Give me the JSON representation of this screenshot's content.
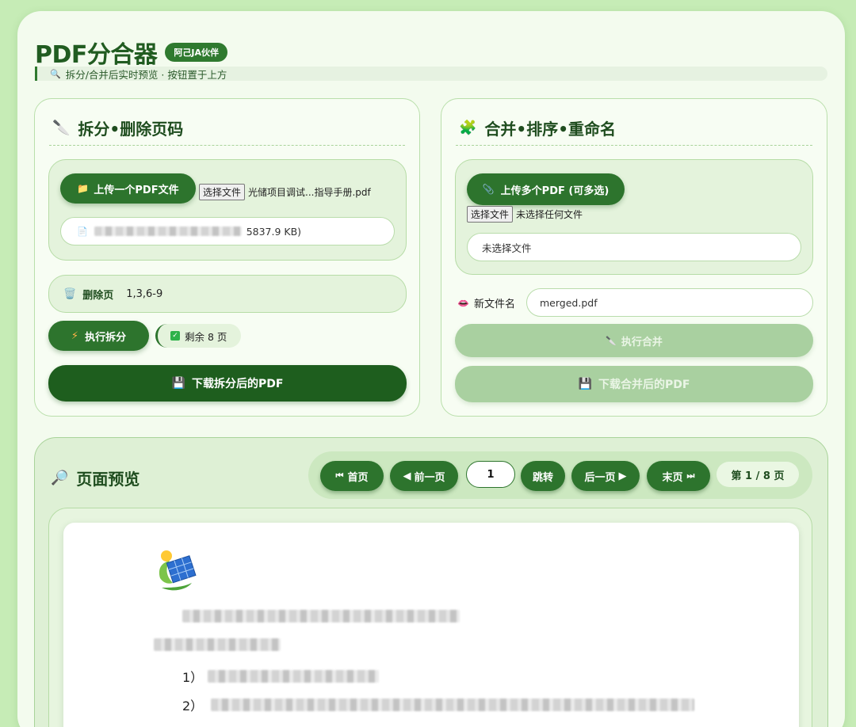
{
  "header": {
    "title": "PDF分合器",
    "badge": "阿己JA伙伴",
    "subtitle": "拆分/合并后实时预览 · 按钮置于上方"
  },
  "split": {
    "title": "拆分•删除页码",
    "upload_button": "上传一个PDF文件",
    "choose_label": "选择文件",
    "chosen_file": "光储项目调试...指导手册.pdf",
    "file_info_suffix": "5837.9 KB)",
    "delete_label": "删除页",
    "delete_value": "1,3,6-9",
    "execute_button": "执行拆分",
    "remaining": "剩余 8 页",
    "download_button": "下载拆分后的PDF"
  },
  "merge": {
    "title": "合并•排序•重命名",
    "upload_button": "上传多个PDF (可多选)",
    "choose_label": "选择文件",
    "no_file": "未选择任何文件",
    "selected_placeholder": "未选择文件",
    "rename_label": "新文件名",
    "rename_value": "merged.pdf",
    "execute_button": "执行合并",
    "download_button": "下载合并后的PDF"
  },
  "preview": {
    "title": "页面预览",
    "first": "首页",
    "prev": "前一页",
    "page_input": "1",
    "jump": "跳转",
    "next": "后一页",
    "last": "末页",
    "page_count": "第 1 / 8 页",
    "doc_line3_prefix": "1）",
    "doc_line4_prefix": "2）"
  },
  "colors": {
    "accent": "#2d742d",
    "background": "#c6ecb6",
    "card": "#f7fdf3",
    "disabled": "#a9d0a0"
  }
}
